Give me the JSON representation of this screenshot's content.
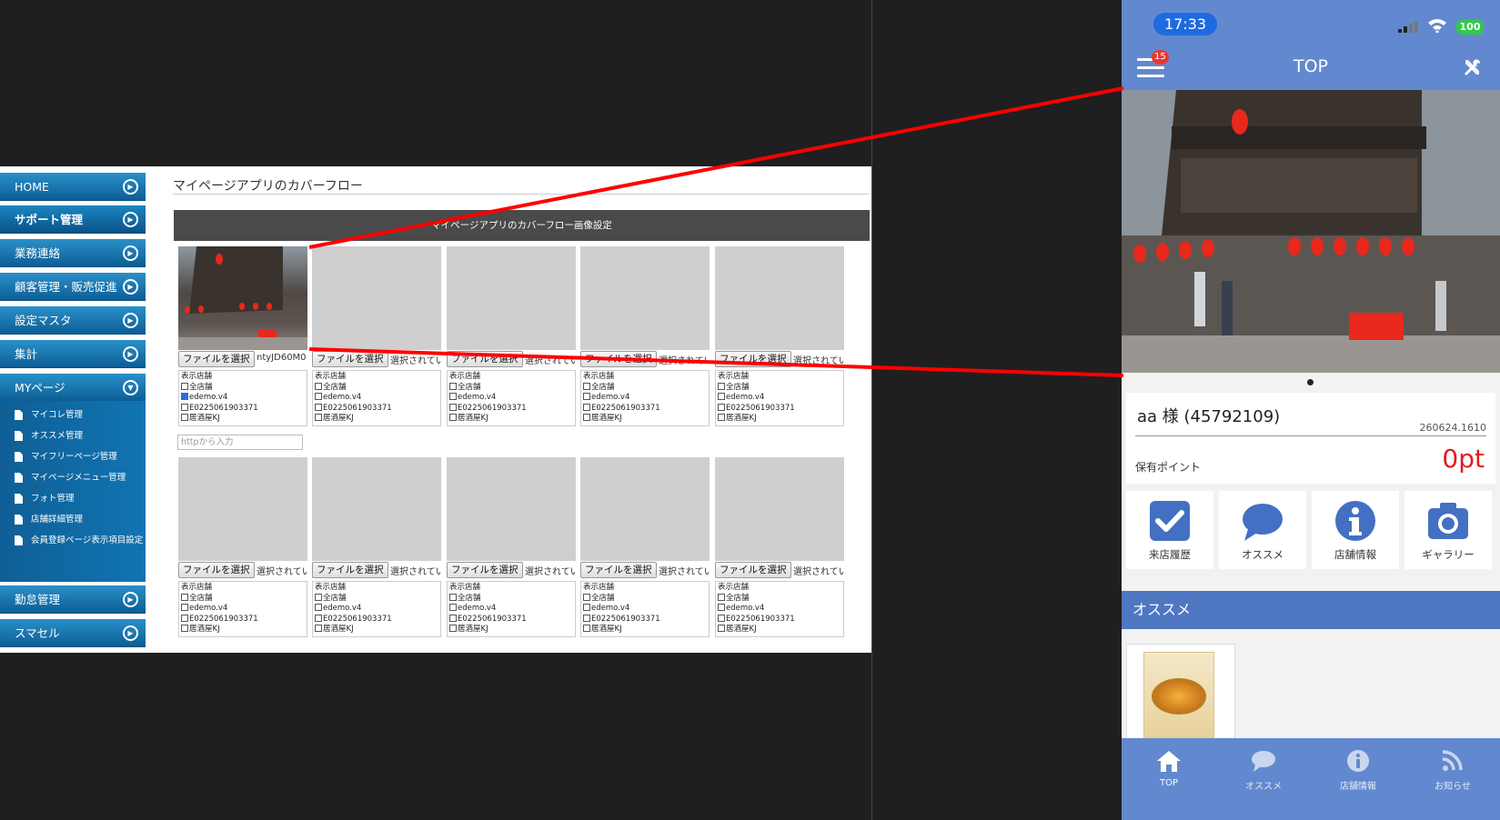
{
  "admin": {
    "sidebar": {
      "items": [
        "HOME",
        "サポート管理",
        "業務連絡",
        "顧客管理・販売促進",
        "設定マスタ",
        "集計",
        "MYページ"
      ],
      "submenu": [
        "マイコレ管理",
        "オススメ管理",
        "マイフリーページ管理",
        "マイページメニュー管理",
        "フォト管理",
        "店舗詳細管理",
        "会員登録ページ表示項目設定"
      ],
      "items_after": [
        "勤怠管理",
        "スマセル"
      ]
    },
    "page_title": "マイページアプリのカバーフロー",
    "section_title": "マイページアプリのカバーフロー画像設定",
    "file_button": "ファイルを選択",
    "first_file_name": "ntyJD60M0",
    "no_file": "選択されてい",
    "store_box": {
      "heading": "表示店舗",
      "options": [
        "全店舗",
        "edemo.v4",
        "E0225061903371",
        "居酒屋KJ"
      ]
    },
    "url_placeholder": "httpから入力"
  },
  "phone": {
    "time": "17:33",
    "battery": "100",
    "menu_badge": "15",
    "title": "TOP",
    "user_name": "aa 様 (45792109)",
    "user_code": "260624.1610",
    "points_label": "保有ポイント",
    "points_value": "0pt",
    "tiles": [
      "来店履歴",
      "オススメ",
      "店舗情報",
      "ギャラリー"
    ],
    "section_title": "オススメ",
    "tabs": [
      "TOP",
      "オススメ",
      "店舗情報",
      "お知らせ"
    ]
  },
  "colors": {
    "app_blue": "#6289cf",
    "tile_icon": "#4470c4",
    "nav_blue": "#0c5e95",
    "highlight_line": "#ff0000"
  }
}
